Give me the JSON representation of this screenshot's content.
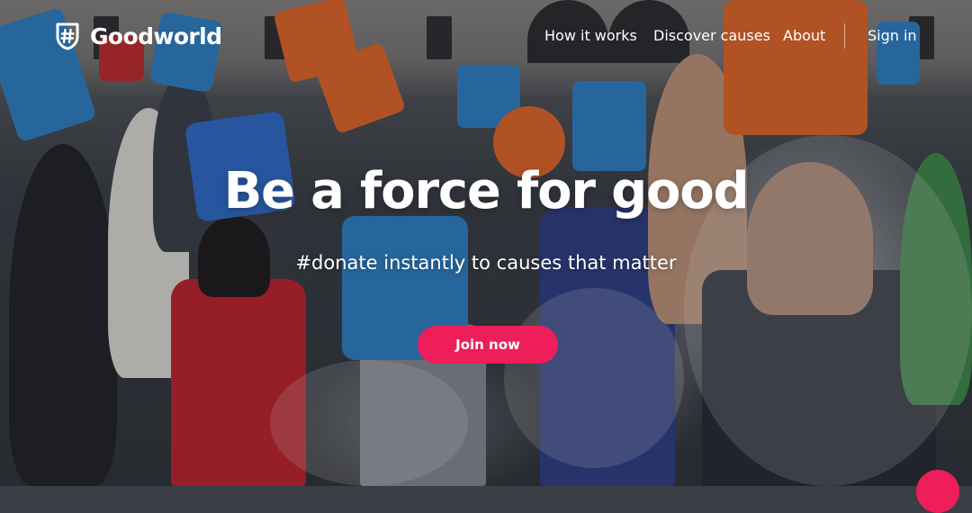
{
  "brand": {
    "name": "Goodworld",
    "logo_icon": "hashtag-shield-icon"
  },
  "nav": {
    "links": [
      "How it works",
      "Discover causes",
      "About"
    ],
    "sign_in": "Sign in"
  },
  "hero": {
    "headline": "Be a force for good",
    "subheadline": "#donate instantly to causes that matter",
    "cta_label": "Join now"
  },
  "colors": {
    "accent": "#ee1e5a",
    "text": "#ffffff",
    "bucket_blue": "#2e86cf",
    "bucket_orange": "#ee6a28"
  }
}
